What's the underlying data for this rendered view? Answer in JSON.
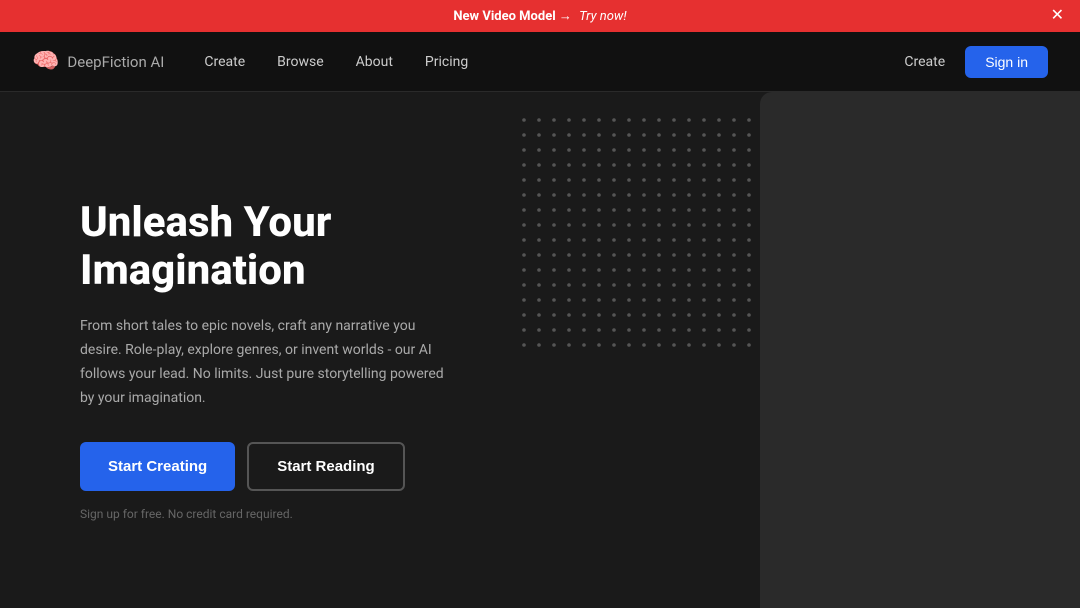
{
  "banner": {
    "text_strong": "New Video Model",
    "text_arrow": "→",
    "text_cta": "Try now!",
    "close_label": "✕"
  },
  "navbar": {
    "logo_icon": "🧠",
    "logo_name": "DeepFiction",
    "logo_suffix": " AI",
    "links": [
      {
        "label": "Create"
      },
      {
        "label": "Browse"
      },
      {
        "label": "About"
      },
      {
        "label": "Pricing"
      }
    ],
    "nav_right_link": "Create",
    "signin_label": "Sign in"
  },
  "hero": {
    "title": "Unleash Your Imagination",
    "description": "From short tales to epic novels, craft any narrative you desire. Role-play, explore genres, or invent worlds - our AI follows your lead. No limits. Just pure storytelling powered by your imagination.",
    "btn_creating": "Start Creating",
    "btn_reading": "Start Reading",
    "signup_note": "Sign up for free. No credit card required."
  }
}
